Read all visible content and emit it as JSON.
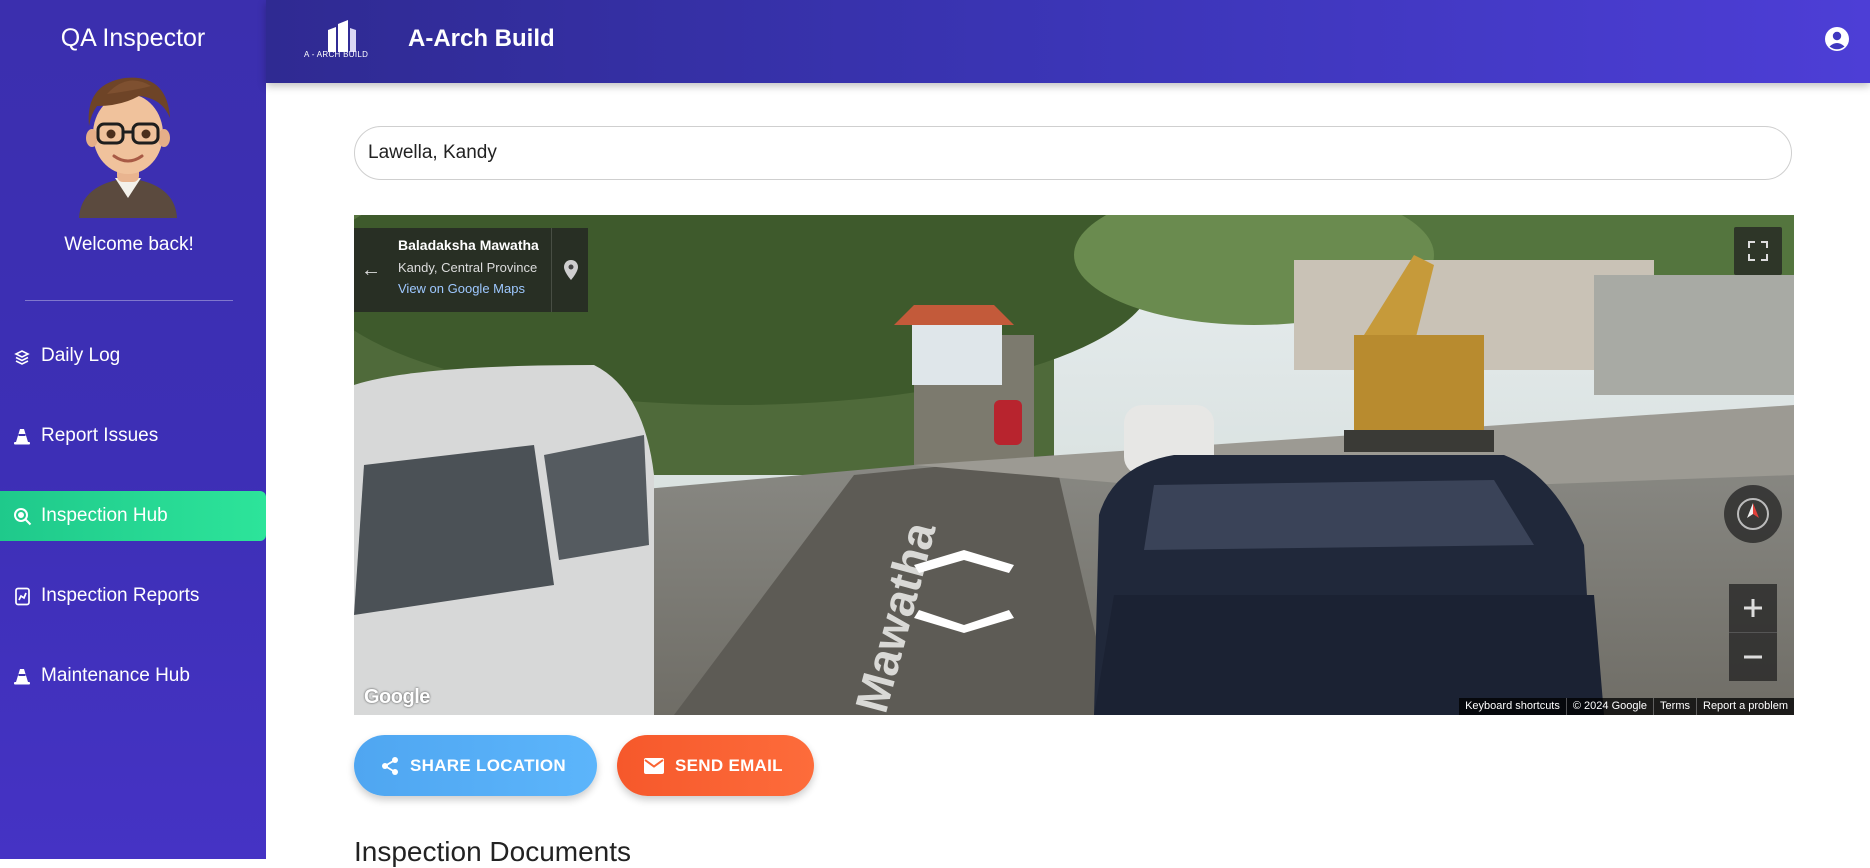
{
  "sidebar": {
    "title": "QA Inspector",
    "welcome": "Welcome back!",
    "items": [
      {
        "label": "Daily Log",
        "icon": "stack-icon",
        "active": false
      },
      {
        "label": "Report Issues",
        "icon": "traffic-cone-icon",
        "active": false
      },
      {
        "label": "Inspection Hub",
        "icon": "search-icon",
        "active": true
      },
      {
        "label": "Inspection Reports",
        "icon": "report-icon",
        "active": false
      },
      {
        "label": "Maintenance Hub",
        "icon": "traffic-cone-icon",
        "active": false
      }
    ]
  },
  "header": {
    "logo_text": "A - ARCH BUILD",
    "brand": "A-Arch Build",
    "account_icon": "account-circle-icon"
  },
  "search": {
    "value": "Lawella, Kandy"
  },
  "streetview": {
    "street": "Baladaksha Mawatha",
    "region": "Kandy, Central Province",
    "link": "View on Google Maps",
    "google_logo": "Google",
    "footer": [
      "Keyboard shortcuts",
      "© 2024 Google",
      "Terms",
      "Report a problem"
    ]
  },
  "actions": {
    "share_label": "SHARE LOCATION",
    "email_label": "SEND EMAIL"
  },
  "section_title": "Inspection Documents",
  "colors": {
    "sidebar_bg": "#3b2fae",
    "active_item": "#2de49a",
    "header_bg": "#3b35b6",
    "share_button": "#56aef6",
    "email_button": "#f96233"
  }
}
